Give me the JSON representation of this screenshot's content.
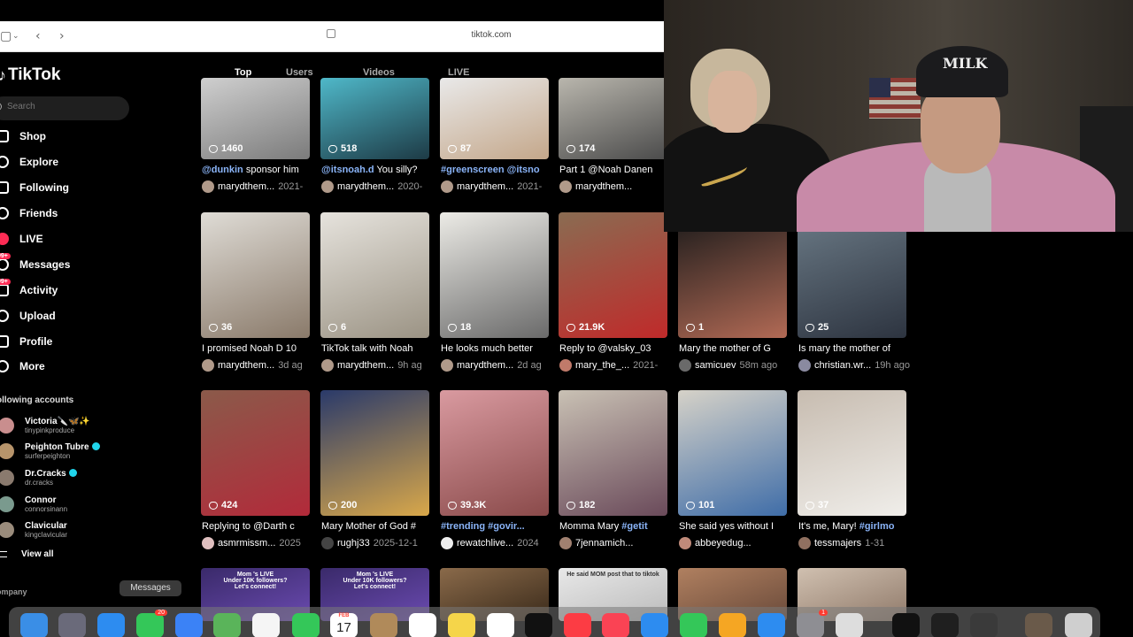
{
  "browser": {
    "url": "tiktok.com",
    "back_icon": "chevron-left-icon",
    "forward_icon": "chevron-right-icon"
  },
  "sidebar": {
    "logo": "TikTok",
    "search_placeholder": "Search",
    "nav": [
      {
        "label": "Shop",
        "icon": "shop-icon",
        "badge": ""
      },
      {
        "label": "Explore",
        "icon": "compass-icon",
        "badge": ""
      },
      {
        "label": "Following",
        "icon": "following-icon",
        "badge": ""
      },
      {
        "label": "Friends",
        "icon": "friends-icon",
        "badge": ""
      },
      {
        "label": "LIVE",
        "icon": "live-icon",
        "badge": ""
      },
      {
        "label": "Messages",
        "icon": "messages-icon",
        "badge": "99+"
      },
      {
        "label": "Activity",
        "icon": "activity-icon",
        "badge": "99+"
      },
      {
        "label": "Upload",
        "icon": "upload-icon",
        "badge": ""
      },
      {
        "label": "Profile",
        "icon": "profile-icon",
        "badge": ""
      },
      {
        "label": "More",
        "icon": "more-icon",
        "badge": ""
      }
    ],
    "following_title": "ollowing accounts",
    "following": [
      {
        "name": "Victoria🔪🦋✨",
        "handle": "tinypinkproduce",
        "verified": false,
        "color": "#c98e8e"
      },
      {
        "name": "Peighton Tubre",
        "handle": "surferpeighton",
        "verified": true,
        "color": "#b7946b"
      },
      {
        "name": "Dr.Cracks",
        "handle": "dr.cracks",
        "verified": true,
        "color": "#8a7a6e"
      },
      {
        "name": "Connor",
        "handle": "connorsinann",
        "verified": false,
        "color": "#7a9a8e"
      },
      {
        "name": "Clavicular",
        "handle": "kingclavicular",
        "verified": false,
        "color": "#9a8c7c"
      }
    ],
    "view_all": "View all",
    "company": "ompany"
  },
  "tabs": [
    "Top",
    "Users",
    "Videos",
    "LIVE"
  ],
  "rows": [
    [
      {
        "likes": "1460",
        "tag": "@dunkin",
        "text": " sponsor him",
        "user": "marydthem...",
        "date": "2021-",
        "c1": "#cfcfcf",
        "c2": "#7b7b7b",
        "av": "#b09a8a"
      },
      {
        "likes": "518",
        "tag": "@itsnoah.d",
        "text": " You silly?",
        "user": "marydthem...",
        "date": "2020-",
        "c1": "#4fb8c9",
        "c2": "#1d3a45",
        "av": "#b09a8a"
      },
      {
        "likes": "87",
        "tag": "#greenscreen @itsno",
        "text": "",
        "user": "marydthem...",
        "date": "2021-",
        "c1": "#e9e9e9",
        "c2": "#c4a78a",
        "av": "#b09a8a"
      },
      {
        "likes": "174",
        "tag": "",
        "text": "Part 1 @Noah Danen",
        "user": "marydthem...",
        "date": "",
        "c1": "#b9b6ad",
        "c2": "#4b4b4b",
        "av": "#b09a8a"
      }
    ],
    [
      {
        "likes": "36",
        "tag": "",
        "text": "I promised Noah D 10",
        "user": "marydthem...",
        "date": "3d ag",
        "c1": "#dfdcd6",
        "c2": "#8a7a6a",
        "av": "#b09a8a"
      },
      {
        "likes": "6",
        "tag": "",
        "text": "TikTok talk with Noah",
        "user": "marydthem...",
        "date": "9h ag",
        "c1": "#e6e3dd",
        "c2": "#9b9384",
        "av": "#b09a8a"
      },
      {
        "likes": "18",
        "tag": "",
        "text": "He looks much better",
        "user": "marydthem...",
        "date": "2d ag",
        "c1": "#ecebe6",
        "c2": "#6a6a6a",
        "av": "#b09a8a"
      },
      {
        "likes": "21.9K",
        "tag": "",
        "text": "Reply to @valsky_03",
        "user": "mary_the_...",
        "date": "2021-",
        "c1": "#8a6c52",
        "c2": "#c02a2a",
        "av": "#c07a6a"
      },
      {
        "likes": "1",
        "tag": "",
        "text": "Mary the mother of G",
        "user": "samicuev",
        "date": "58m ago",
        "c1": "#1a1a1a",
        "c2": "#b26a55",
        "av": "#6a6a6a"
      },
      {
        "likes": "25",
        "tag": "",
        "text": "Is mary the mother of",
        "user": "christian.wr...",
        "date": "19h ago",
        "c1": "#6b7a86",
        "c2": "#2d3440",
        "av": "#8a8aa0"
      }
    ],
    [
      {
        "likes": "424",
        "tag": "",
        "text": "Replying to @Darth c",
        "user": "asmrmissm...",
        "date": "2025",
        "c1": "#8b5a4a",
        "c2": "#b22a3a",
        "av": "#e0c0c0"
      },
      {
        "likes": "200",
        "tag": "",
        "text": "Mary Mother of God #",
        "user": "rughj33",
        "date": "2025-12-1",
        "c1": "#2a3a6a",
        "c2": "#d9a84a",
        "av": "#444444"
      },
      {
        "likes": "39.3K",
        "tag": "#trending #govir...",
        "text": "",
        "user": "rewatchlive...",
        "date": "2024",
        "c1": "#d99aa0",
        "c2": "#8a4a4a",
        "av": "#eeeeee"
      },
      {
        "likes": "182",
        "tag": "#getit",
        "text": "Momma Mary ",
        "user": "7jennamich...",
        "date": "",
        "c1": "#c9c1b4",
        "c2": "#6a4a5a",
        "av": "#a08070"
      },
      {
        "likes": "101",
        "tag": "",
        "text": "She said yes without I",
        "user": "abbeyedug...",
        "date": "",
        "c1": "#d6d2c8",
        "c2": "#3f6da8",
        "av": "#c08a7a"
      },
      {
        "likes": "37",
        "tag": "#girlmo",
        "text": "It's me, Mary! ",
        "user": "tessmajers",
        "date": "1-31",
        "c1": "#c7bcb0",
        "c2": "#f0eeea",
        "av": "#907060"
      }
    ],
    [
      {
        "overlay": "Mom 's LIVE\nUnder 10K followers?\nLet's connect!",
        "c1": "#3a2a6a",
        "c2": "#6a4ab0"
      },
      {
        "overlay": "Mom 's LIVE\nUnder 10K followers?\nLet's connect!",
        "c1": "#3a2a6a",
        "c2": "#6a4ab0"
      },
      {
        "overlay": "",
        "c1": "#8a6a4a",
        "c2": "#3a2a1a"
      },
      {
        "overlay": "He said MOM post that to tiktok",
        "c1": "#e8e8e8",
        "c2": "#bbbbbb"
      },
      {
        "overlay": "",
        "c1": "#b08060",
        "c2": "#6a4a3a"
      },
      {
        "overlay": "",
        "c1": "#d0c0b0",
        "c2": "#907a6a"
      }
    ]
  ],
  "webcam": {
    "cap_text": "MILK"
  },
  "dock": {
    "tooltip": "Messages",
    "messages_badge": "20",
    "settings_badge": "1",
    "calendar_month": "FEB",
    "calendar_day": "17",
    "icons": [
      {
        "name": "finder-icon",
        "color": "#3a8ee6"
      },
      {
        "name": "launchpad-icon",
        "color": "#6a6a7a"
      },
      {
        "name": "safari-icon",
        "color": "#2d8cf0"
      },
      {
        "name": "messages-app-icon",
        "color": "#34c759"
      },
      {
        "name": "mail-icon",
        "color": "#3b82f6"
      },
      {
        "name": "maps-icon",
        "color": "#5ab45a"
      },
      {
        "name": "photos-icon",
        "color": "#f5f5f5"
      },
      {
        "name": "facetime-icon",
        "color": "#34c759"
      },
      {
        "name": "calendar-icon",
        "color": "#ffffff"
      },
      {
        "name": "contacts-icon",
        "color": "#b08a5a"
      },
      {
        "name": "reminders-icon",
        "color": "#ffffff"
      },
      {
        "name": "notes-icon",
        "color": "#f5d54a"
      },
      {
        "name": "freeform-icon",
        "color": "#ffffff"
      },
      {
        "name": "tv-icon",
        "color": "#111111"
      },
      {
        "name": "music-icon",
        "color": "#fc3c44"
      },
      {
        "name": "news-icon",
        "color": "#fa4354"
      },
      {
        "name": "keynote-icon",
        "color": "#2d8cf0"
      },
      {
        "name": "numbers-icon",
        "color": "#34c759"
      },
      {
        "name": "pages-icon",
        "color": "#f5a623"
      },
      {
        "name": "app-store-icon",
        "color": "#2d8cf0"
      },
      {
        "name": "system-settings-icon",
        "color": "#8e8e93"
      },
      {
        "name": "iphone-mirroring-icon",
        "color": "#dddddd"
      },
      {
        "name": "capcut-icon",
        "color": "#111111"
      },
      {
        "name": "whatsapp-icon",
        "color": "#1f1f1f"
      },
      {
        "name": "quicktime-icon",
        "color": "#3a3a3a"
      },
      {
        "name": "recent-app-icon",
        "color": "#6a5a4a"
      },
      {
        "name": "trash-icon",
        "color": "#cfcfcf"
      }
    ]
  }
}
